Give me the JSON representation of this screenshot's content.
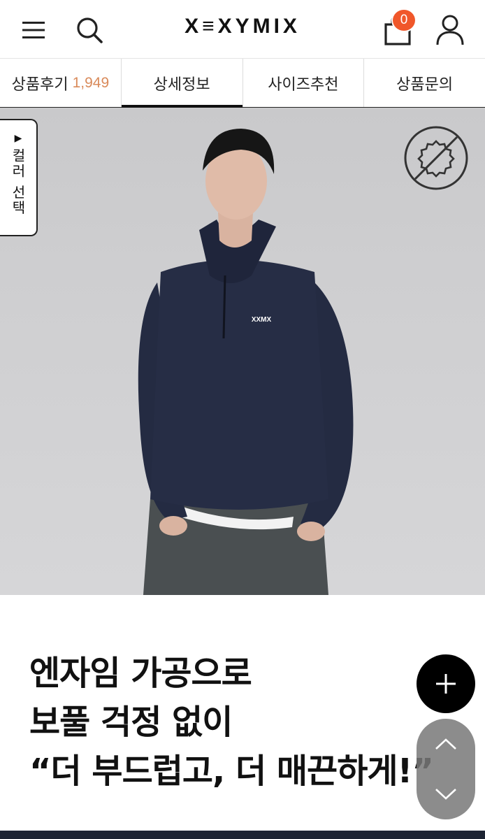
{
  "header": {
    "logo_text": "X≡XYMIX",
    "cart_count": "0",
    "icons": [
      "hamburger-menu-icon",
      "search-icon",
      "shopping-bag-icon",
      "user-icon"
    ]
  },
  "tabs": [
    {
      "label": "상품후기",
      "count": "1,949"
    },
    {
      "label": "상세정보",
      "active": true
    },
    {
      "label": "사이즈추천"
    },
    {
      "label": "상품문의"
    }
  ],
  "color_select": {
    "arrow": "▶",
    "label": "컬러 선택"
  },
  "product_image": {
    "chest_logo": "XXMX",
    "badge_icon": "no-pilling-icon"
  },
  "headline": {
    "line1": "엔자임 가공으로",
    "line2": "보풀 걱정 없이",
    "line3": "“더 부드럽고, 더 매끈하게!”"
  },
  "colors": {
    "accent": "#f0572a",
    "review_count": "#d98a5a",
    "sweatshirt": "#252c44"
  }
}
